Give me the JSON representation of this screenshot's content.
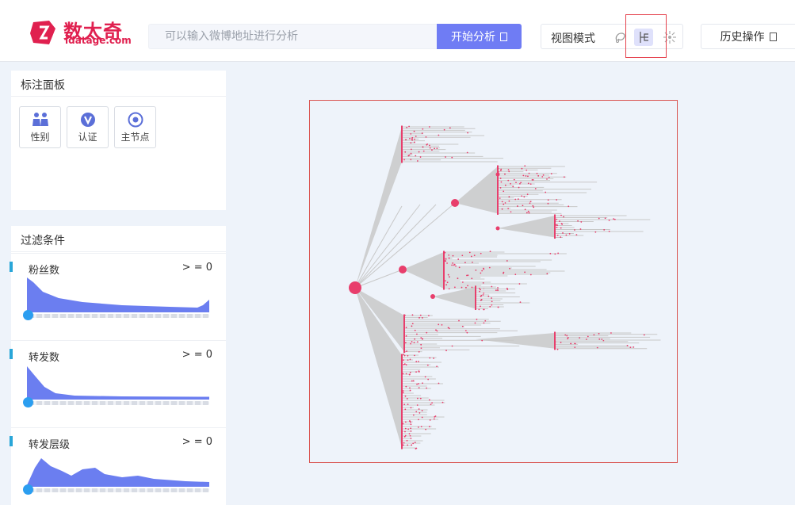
{
  "header": {
    "logo_name": "数太奇",
    "logo_domain": "idatage.com",
    "search_placeholder": "可以输入微博地址进行分析",
    "analyze_label": "开始分析",
    "view_mode_label": "视图模式",
    "view_icons": [
      "lasso-icon",
      "tree-icon",
      "radial-icon"
    ],
    "active_view": "tree-icon",
    "history_label": "历史操作"
  },
  "annotation_panel": {
    "title": "标注面板",
    "buttons": [
      {
        "label": "性别",
        "icon": "gender-icon"
      },
      {
        "label": "认证",
        "icon": "verified-icon"
      },
      {
        "label": "主节点",
        "icon": "main-node-icon"
      }
    ]
  },
  "filter_panel": {
    "title": "过滤条件",
    "items": [
      {
        "label": "粉丝数",
        "value": "> = 0"
      },
      {
        "label": "转发数",
        "value": "> = 0"
      },
      {
        "label": "转发层级",
        "value": "> = 0"
      }
    ]
  },
  "colors": {
    "accent": "#6f7cf4",
    "brand": "#e0204f",
    "node": "#e83e6c",
    "edge": "#c8c8c8",
    "histogram": "#6b7ef0",
    "slider_knob": "#2b9ef0"
  }
}
